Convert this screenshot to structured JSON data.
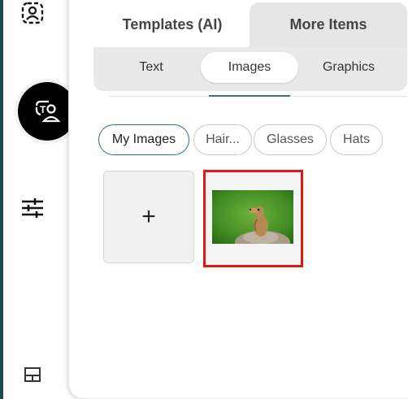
{
  "top_tabs": [
    {
      "label": "Templates (AI)"
    },
    {
      "label": "More Items"
    }
  ],
  "sub_tabs": [
    {
      "label": "Text"
    },
    {
      "label": "Images"
    },
    {
      "label": "Graphics"
    }
  ],
  "filter_chips": [
    {
      "label": "My Images"
    },
    {
      "label": "Hair..."
    },
    {
      "label": "Glasses"
    },
    {
      "label": "Hats"
    }
  ],
  "add_tile": {
    "label": "+"
  },
  "rail_icons": [
    "user-profile-icon",
    "text-people-icon",
    "sliders-icon",
    "layout-icon"
  ],
  "colors": {
    "accent": "#2d6f8f",
    "selection_border": "#e0161b",
    "rail_active": "#000000"
  }
}
